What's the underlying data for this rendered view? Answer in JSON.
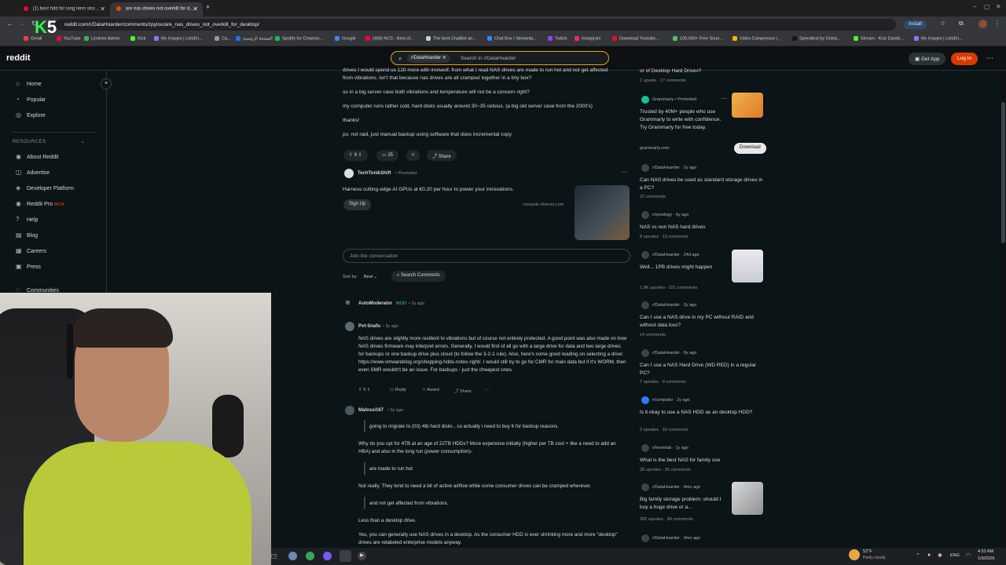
{
  "browser": {
    "tabs": [
      {
        "label": "(1) best hdd for long term stor..."
      },
      {
        "label": "are nas drives not overkill for d..."
      }
    ],
    "new_tab": "+",
    "url": "reddit.com/r/DataHoarder/comments/zpylou/are_nas_drives_not_overkill_for_desktop/",
    "install_label": "Install",
    "bookmarks": [
      "Gmail",
      "YouTube",
      "Limitree Admin",
      "Kick",
      "My images | LetsEn...",
      "Ca...",
      "الصفحة الرئيسية",
      "Spotify for Creators...",
      "Google",
      "(458) NCS - Best of...",
      "The best ChatBot an...",
      "Chat Box / Streamla...",
      "Twitch",
      "Instagram",
      "Download Youtube...",
      "100,000+ Free Soun...",
      "Video Compressor |...",
      "Speedtest by Ookla...",
      "Stream - Kick Dashb...",
      "My images | LetsEn..."
    ]
  },
  "header": {
    "logo": "reddit",
    "search_chip": "r/DataHoarder",
    "search_placeholder": "Search in r/DataHoarder",
    "get_app": "Get App",
    "login": "Log In"
  },
  "sidebar": {
    "items": [
      {
        "label": "Home",
        "icon": "home-icon"
      },
      {
        "label": "Popular",
        "icon": "popular-icon"
      },
      {
        "label": "Explore",
        "icon": "explore-icon"
      }
    ],
    "resources_heading": "RESOURCES",
    "resources": [
      {
        "label": "About Reddit"
      },
      {
        "label": "Advertise"
      },
      {
        "label": "Developer Platform"
      },
      {
        "label": "Reddit Pro",
        "badge": "BETA"
      },
      {
        "label": "Help"
      },
      {
        "label": "Blog"
      },
      {
        "label": "Careers"
      },
      {
        "label": "Press"
      },
      {
        "label": "Communities"
      }
    ]
  },
  "post": {
    "lines": [
      "drives I would spend us 120 more with ironwolf. from what I read NAS drives are made to run hot and not get affected",
      "from vibrations. isn't that because nas drives are all cramped together in a tiny box?",
      "so in a big server case both vibrations and temperature will not be a concern right?",
      "my computer runs rather cold, hard disks usually around 30~35 celsius. (a big old server case from the 2000's)",
      "thanks!",
      "ps: not raid, just manual backup using software that does incremental copy"
    ],
    "votes": "9",
    "comments": "25",
    "share": "Share"
  },
  "ad": {
    "author": "TechTonikShift",
    "promoted": "Promoted",
    "text": "Harness cutting-edge AI GPUs at €0.20 per hour to power your innovations.",
    "signup": "Sign Up",
    "domain": "compute.hivenet.com"
  },
  "join_placeholder": "Join the conversation",
  "sort": {
    "label": "Sort by:",
    "value": "Best",
    "search": "Search Comments"
  },
  "comments": [
    {
      "author": "AutoModerator",
      "badge": "MOD",
      "age": "3y ago"
    },
    {
      "author": "Pvt-Snafu",
      "age": "3y ago",
      "body": "NAS drives are slightly more resilient to vibrations but of course not entirely protected. A good point was also made on how NAS drives firmware may interpret errors. Generally, I would first of all go with a large drive for data and two large drives for backups or one backup drive plus cloud (to follow the 3-2-1 rule). Also, here's some good reading on selecting a drive: https://www.vmwareblog.org/shopping-hdds-notes-right/. I would still try to go for CMR for main data but if it's WORM, then even SMR wouldn't be an issue. For backups - just the cheapest ones.",
      "votes": "9",
      "reply": "Reply",
      "award": "Award",
      "share": "Share"
    },
    {
      "author": "Malossi167",
      "age": "3y ago",
      "quote1": "going to migrate to (03) 4tb hard disks , so actually i need to buy 6 for backup reasons.",
      "p1": "Why do you opt for 4TB at an age of 22TB HDDs? More expensive initially (higher per TB cost + like a need to add an HBA) and also in the long run (power consumption)-",
      "quote2": "are made to run hot",
      "p2": "Not really. They tend to need a bit of active airflow while some consumer drives can be cramped wherever.",
      "quote3": "and not get affected from vibrations.",
      "p3": "Less than a desktop drive.",
      "p4": "Yes, you can generally use NAS drives in a desktop. As the consumer HDD is ever shrinking more and more \"desktop\" drives are relabeled enterprise models anyway."
    }
  ],
  "rail": {
    "top_title": "or of Desktop Hard Drives?",
    "top_stats": "1 upvote · 17 comments",
    "promo": {
      "name": "Grammarly",
      "promoted": "Promoted",
      "text": "Trusted by 40M+ people who use Grammarly to write with confidence. Try Grammarly for free today.",
      "domain": "grammarly.com",
      "button": "Download"
    },
    "items": [
      {
        "sub": "r/DataHoarder · 2y ago",
        "title": "Can NAS drives be used as standard storage drives in a PC?",
        "stats": "22 comments"
      },
      {
        "sub": "r/synology · 6y ago",
        "title": "NAS vs non NAS hard drives",
        "stats": "8 upvotes · 13 comments"
      },
      {
        "sub": "r/DataHoarder · 24d ago",
        "title": "Well... 1PB drives might happen",
        "stats": "1.9K upvotes · 321 comments"
      },
      {
        "sub": "r/DataHoarder · 2y ago",
        "title": "Can I use a NAS drive in my PC without RAID and without data loss?",
        "stats": "14 comments"
      },
      {
        "sub": "r/DataHoarder · 9y ago",
        "title": "Can I use a NAS Hard Drive (WD RED) in a regular PC?",
        "stats": "7 upvotes · 9 comments"
      },
      {
        "sub": "r/computer · 2y ago",
        "title": "Is it okay to use a NAS HDD as an desktop HDD?",
        "stats": "3 upvotes · 18 comments"
      },
      {
        "sub": "r/homelab · 1y ago",
        "title": "What is the best NAS for family use",
        "stats": "28 upvotes · 35 comments"
      },
      {
        "sub": "r/DataHoarder · 4mo ago",
        "title": "Big family storage problem: should I buy a huge drive or a...",
        "stats": "282 upvotes · 89 comments"
      },
      {
        "sub": "r/DataHoarder · 9mo ago",
        "title": "",
        "stats": ""
      }
    ]
  },
  "taskbar": {
    "weather_temp": "52°F",
    "weather_desc": "Partly cloudy",
    "lang": "ENG",
    "time": "4:53 AM",
    "date": "1/9/2026"
  },
  "overlay": {
    "logo_k": "K",
    "logo_5": "5"
  },
  "colors": {
    "accent_search": "#e0a510",
    "login": "#d93a00",
    "link": "#6ba4ff",
    "mod": "#46d160"
  }
}
